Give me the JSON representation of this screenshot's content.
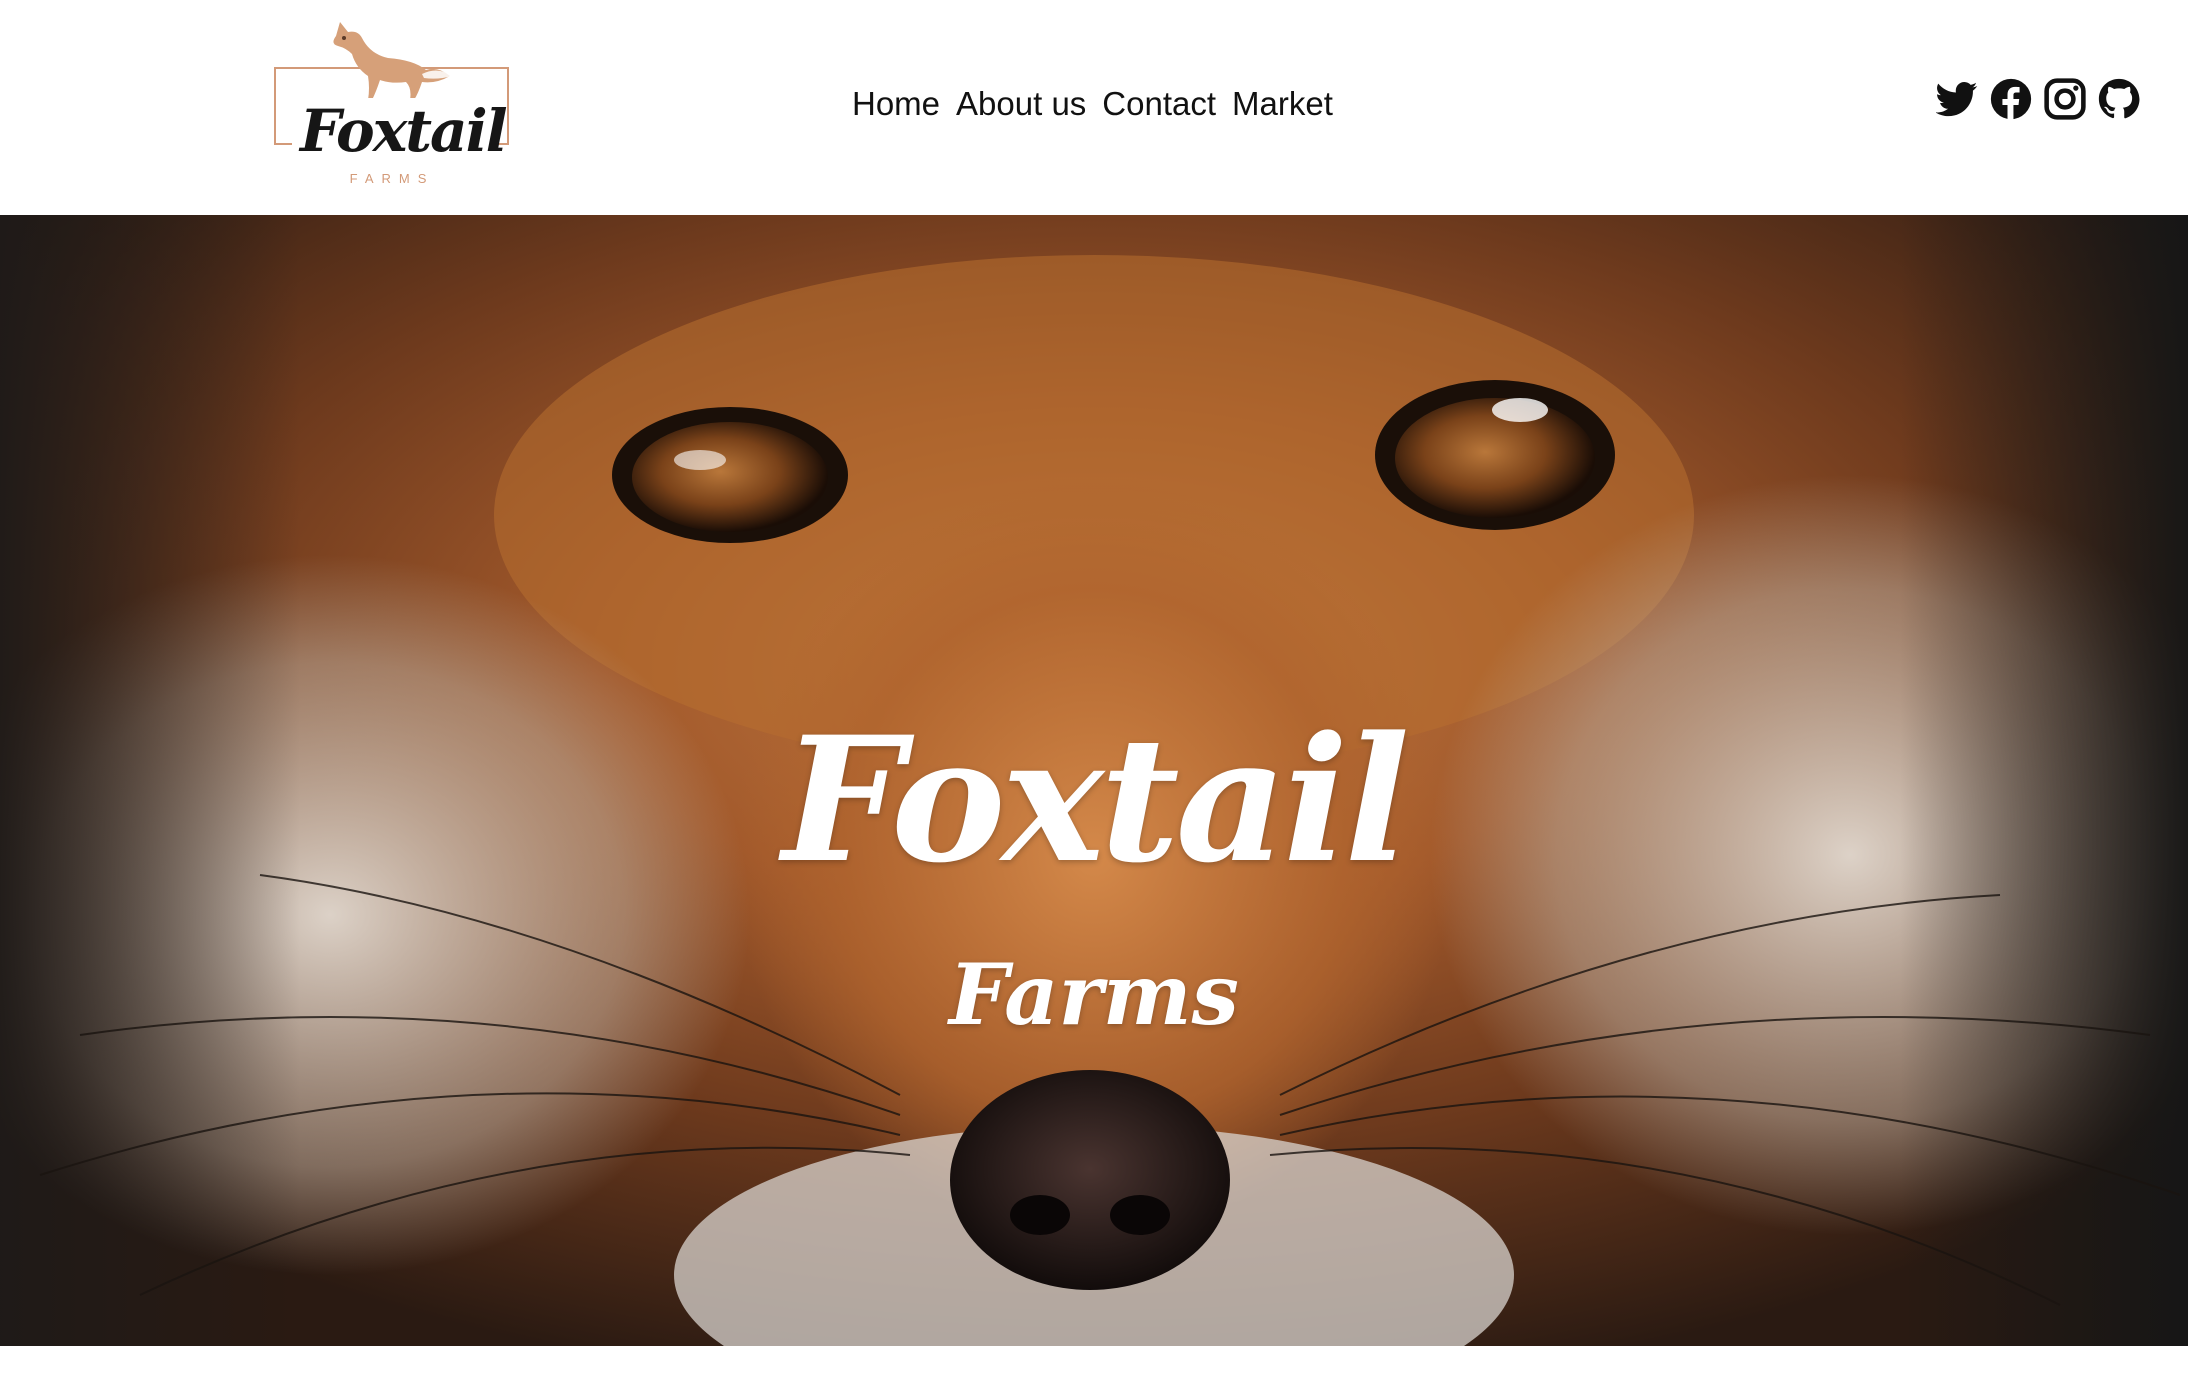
{
  "brand": {
    "logo_title": "Foxtail",
    "logo_subtitle": "FARMS",
    "accent_color": "#d39a78",
    "logo_icon": "fox-icon"
  },
  "nav": {
    "items": [
      {
        "label": "Home"
      },
      {
        "label": "About us"
      },
      {
        "label": "Contact"
      },
      {
        "label": "Market"
      }
    ]
  },
  "social": {
    "icons": [
      "twitter-icon",
      "facebook-icon",
      "instagram-icon",
      "github-icon"
    ]
  },
  "hero": {
    "title": "Foxtail",
    "subtitle": "Farms",
    "image_subject": "fox-face-photo"
  }
}
